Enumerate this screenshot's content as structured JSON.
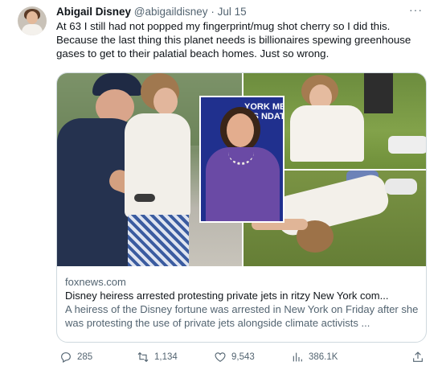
{
  "author": {
    "name": "Abigail Disney",
    "handle": "@abigaildisney",
    "separator": "·",
    "date": "Jul 15"
  },
  "tweet_text": "At 63 I still had not popped my fingerprint/mug shot cherry so I did this. Because the last thing this planet needs is billionaires spewing greenhouse gases to get to their palatial beach homes. Just so wrong.",
  "more_label": "···",
  "link_card": {
    "domain": "foxnews.com",
    "headline": "Disney heiress arrested protesting private jets in ritzy New York com...",
    "description": "A heiress of the Disney fortune was arrested in New York on Friday after she was protesting the use of private jets alongside climate activists ...",
    "inset_sign": "YORK MEN'S NDATIO"
  },
  "actions": {
    "replies": "285",
    "retweets": "1,134",
    "likes": "9,543",
    "views": "386.1K"
  },
  "colors": {
    "text_primary": "#0f1419",
    "text_secondary": "#536471",
    "border": "#cfd9de",
    "inset_background": "#20308e"
  }
}
